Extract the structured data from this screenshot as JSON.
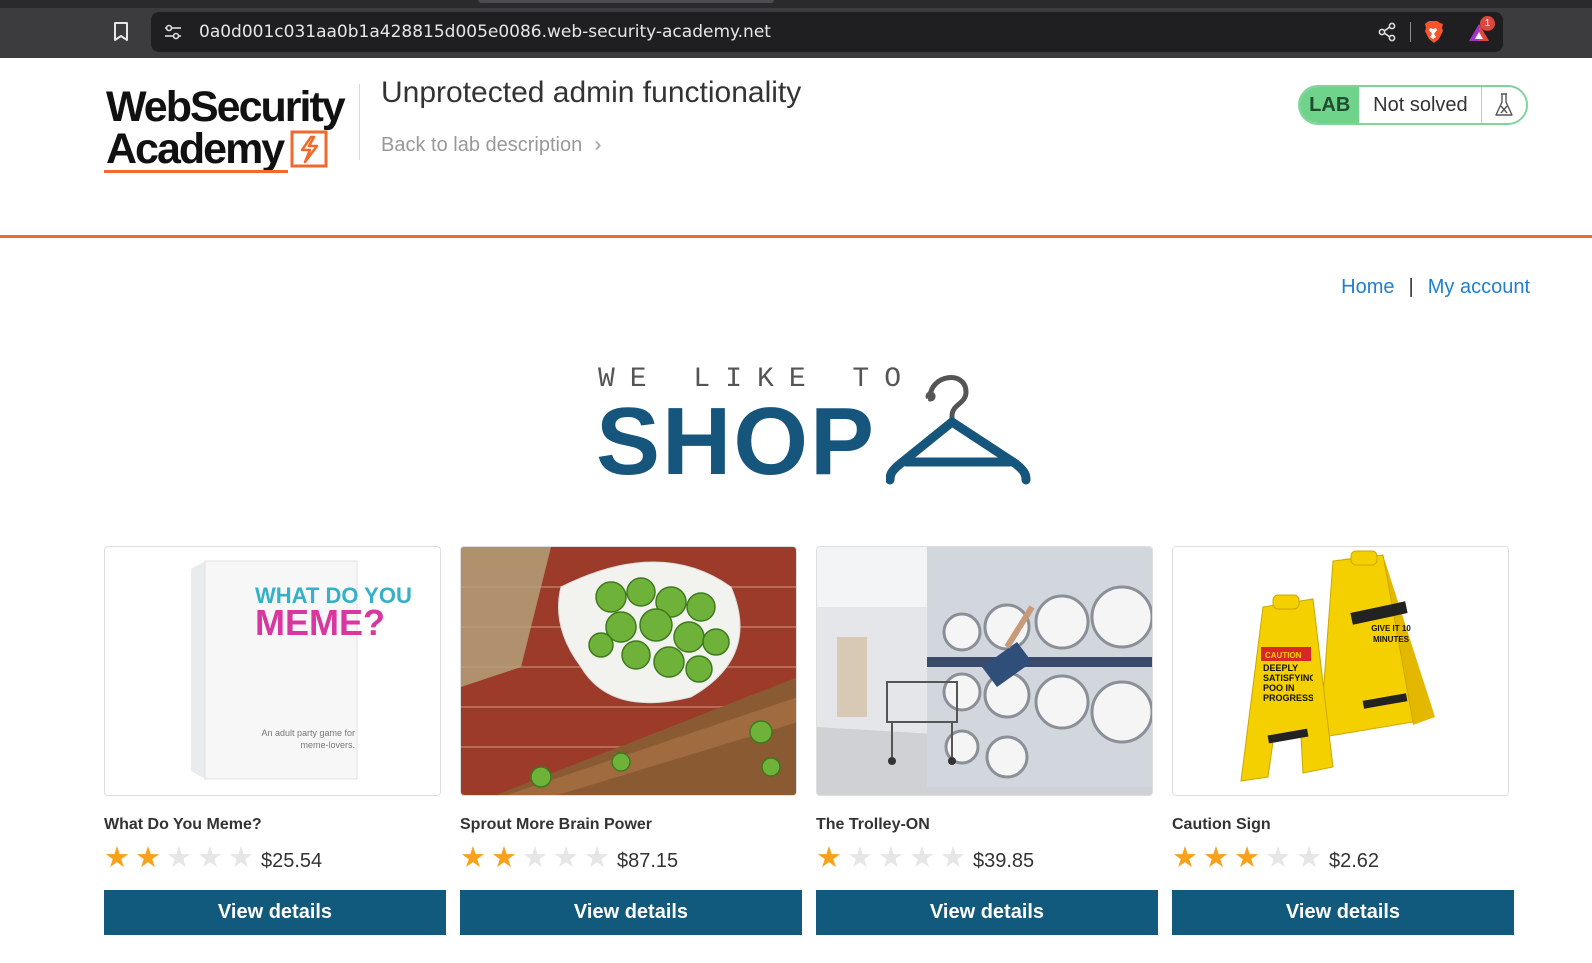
{
  "browser": {
    "url": "0a0d001c031aa0b1a428815d005e0086.web-security-academy.net",
    "rewards_badge": "1"
  },
  "lab": {
    "logo_line1": "WebSecurity",
    "logo_line2": "Academy",
    "title": "Unprotected admin functionality",
    "back_link": "Back to lab description",
    "badge": "LAB",
    "status": "Not solved",
    "colors": {
      "accent": "#f06a2b",
      "solved_badge": "#6fd38b"
    }
  },
  "nav": {
    "home": "Home",
    "separator": "|",
    "my_account": "My account"
  },
  "banner": {
    "top_text": "WE LIKE TO",
    "shop_text": "SHOP",
    "color": "#16567c"
  },
  "products": [
    {
      "name": "What Do You Meme?",
      "rating": 2,
      "price": "$25.54",
      "button": "View details",
      "image_text": {
        "line1": "WHAT DO YOU",
        "line2": "MEME?",
        "tagline": "An adult party game for meme-lovers."
      }
    },
    {
      "name": "Sprout More Brain Power",
      "rating": 2,
      "price": "$87.15",
      "button": "View details"
    },
    {
      "name": "The Trolley-ON",
      "rating": 1,
      "price": "$39.85",
      "button": "View details"
    },
    {
      "name": "Caution Sign",
      "rating": 3,
      "price": "$2.62",
      "button": "View details",
      "image_text": {
        "line1": "CAUTION",
        "line2": "DEEPLY SATISFYING POO IN PROGRESS",
        "line3": "GIVE IT 10 MINUTES"
      }
    }
  ],
  "button_color": "#115a7d"
}
